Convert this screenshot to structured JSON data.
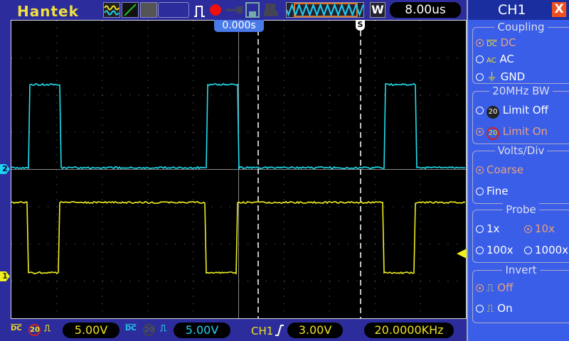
{
  "brand": "Hantek",
  "toolbar": {
    "icons": [
      "channel-waveform-icon",
      "math-icon",
      "ref-icon",
      "blank-slot",
      "pulse-icon",
      "record-icon",
      "key-icon",
      "save-icon",
      "print-icon"
    ]
  },
  "timebase": {
    "mode": "W",
    "value": "8.00us"
  },
  "trigger_position": "0.000s",
  "trigger_marker": "S",
  "panel": {
    "title": "CH1",
    "close": "X",
    "coupling": {
      "title": "Coupling",
      "options": [
        {
          "label": "DC",
          "selected": true
        },
        {
          "label": "AC",
          "selected": false
        },
        {
          "label": "GND",
          "selected": false
        }
      ]
    },
    "bw": {
      "title": "20MHz BW",
      "options": [
        {
          "label": "Limit Off",
          "selected": false
        },
        {
          "label": "Limit On",
          "selected": true
        }
      ]
    },
    "vdiv": {
      "title": "Volts/Div",
      "options": [
        {
          "label": "Coarse",
          "selected": true
        },
        {
          "label": "Fine",
          "selected": false
        }
      ]
    },
    "probe": {
      "title": "Probe",
      "options": [
        {
          "label": "1x",
          "selected": false
        },
        {
          "label": "10x",
          "selected": true
        },
        {
          "label": "100x",
          "selected": false
        },
        {
          "label": "1000x",
          "selected": false
        }
      ]
    },
    "invert": {
      "title": "Invert",
      "options": [
        {
          "label": "Off",
          "selected": true
        },
        {
          "label": "On",
          "selected": false
        }
      ]
    }
  },
  "status": {
    "ch1": {
      "coupling": "DC",
      "bw": "20",
      "volts": "5.00V"
    },
    "ch2": {
      "coupling": "DC",
      "bw": "20",
      "volts": "5.00V"
    },
    "trigger": {
      "source": "CH1",
      "level": "3.00V"
    },
    "frequency": "20.0000KHz"
  },
  "markers": {
    "ch1": "1",
    "ch2": "2"
  },
  "colors": {
    "ch1": "#f0f020",
    "ch2": "#20e0f0",
    "panel": "#3a5ee8",
    "background": "#2c2c9c"
  }
}
